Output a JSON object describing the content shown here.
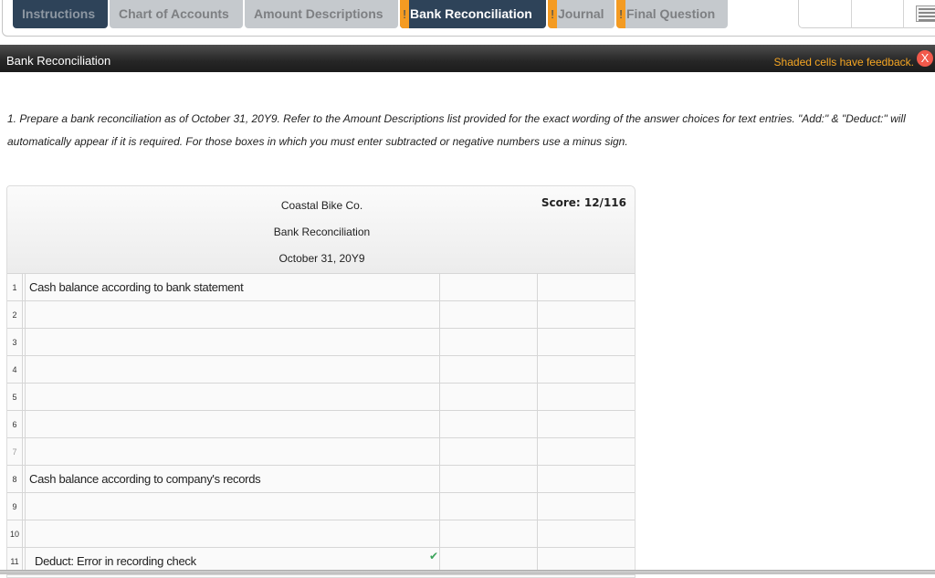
{
  "tabs": [
    {
      "label": "Instructions",
      "state": "visited",
      "flag": null
    },
    {
      "label": "Chart of Accounts",
      "state": "inactive",
      "flag": null
    },
    {
      "label": "Amount Descriptions",
      "state": "inactive",
      "flag": null
    },
    {
      "label": "Bank Reconciliation",
      "state": "active",
      "flag": "!"
    },
    {
      "label": "Journal",
      "state": "inactive",
      "flag": "!"
    },
    {
      "label": "Final Question",
      "state": "inactive",
      "flag": "!"
    }
  ],
  "colors": {
    "tab_active": "#2e4359",
    "tab_inactive": "#c5c9cd",
    "flag": "#f49b22",
    "feedback_text": "#f5a623",
    "close_button": "#f2594b",
    "check": "#3aa35a"
  },
  "section": {
    "title": "Bank Reconciliation",
    "feedback_note": "Shaded cells have feedback.",
    "close_label": "X"
  },
  "instructions": "1. Prepare a bank reconciliation as of October 31, 20Y9. Refer to the Amount Descriptions list provided for the exact wording of the answer choices for text entries. \"Add:\" & \"Deduct:\" will automatically appear if it is required. For those boxes in which you must enter subtracted or negative numbers use a minus sign.",
  "worksheet": {
    "company": "Coastal Bike Co.",
    "title": "Bank Reconciliation",
    "date": "October 31, 20Y9",
    "score": "Score: 12/116",
    "rows": [
      {
        "num": "1",
        "desc": "Cash balance according to bank statement",
        "col1": "",
        "col2": "",
        "check": false
      },
      {
        "num": "2",
        "desc": "",
        "col1": "",
        "col2": "",
        "check": false
      },
      {
        "num": "3",
        "desc": "",
        "col1": "",
        "col2": "",
        "check": false
      },
      {
        "num": "4",
        "desc": "",
        "col1": "",
        "col2": "",
        "check": false
      },
      {
        "num": "5",
        "desc": "",
        "col1": "",
        "col2": "",
        "check": false
      },
      {
        "num": "6",
        "desc": "",
        "col1": "",
        "col2": "",
        "check": false
      },
      {
        "num": "7",
        "desc": "",
        "col1": "",
        "col2": "",
        "check": false
      },
      {
        "num": "8",
        "desc": "Cash balance according to company's records",
        "col1": "",
        "col2": "",
        "check": false
      },
      {
        "num": "9",
        "desc": "",
        "col1": "",
        "col2": "",
        "check": false
      },
      {
        "num": "10",
        "desc": "",
        "col1": "",
        "col2": "",
        "check": false
      },
      {
        "num": "11",
        "desc": "Deduct: Error in recording check",
        "col1": "",
        "col2": "",
        "check": true
      }
    ],
    "check_icon": "✔"
  }
}
